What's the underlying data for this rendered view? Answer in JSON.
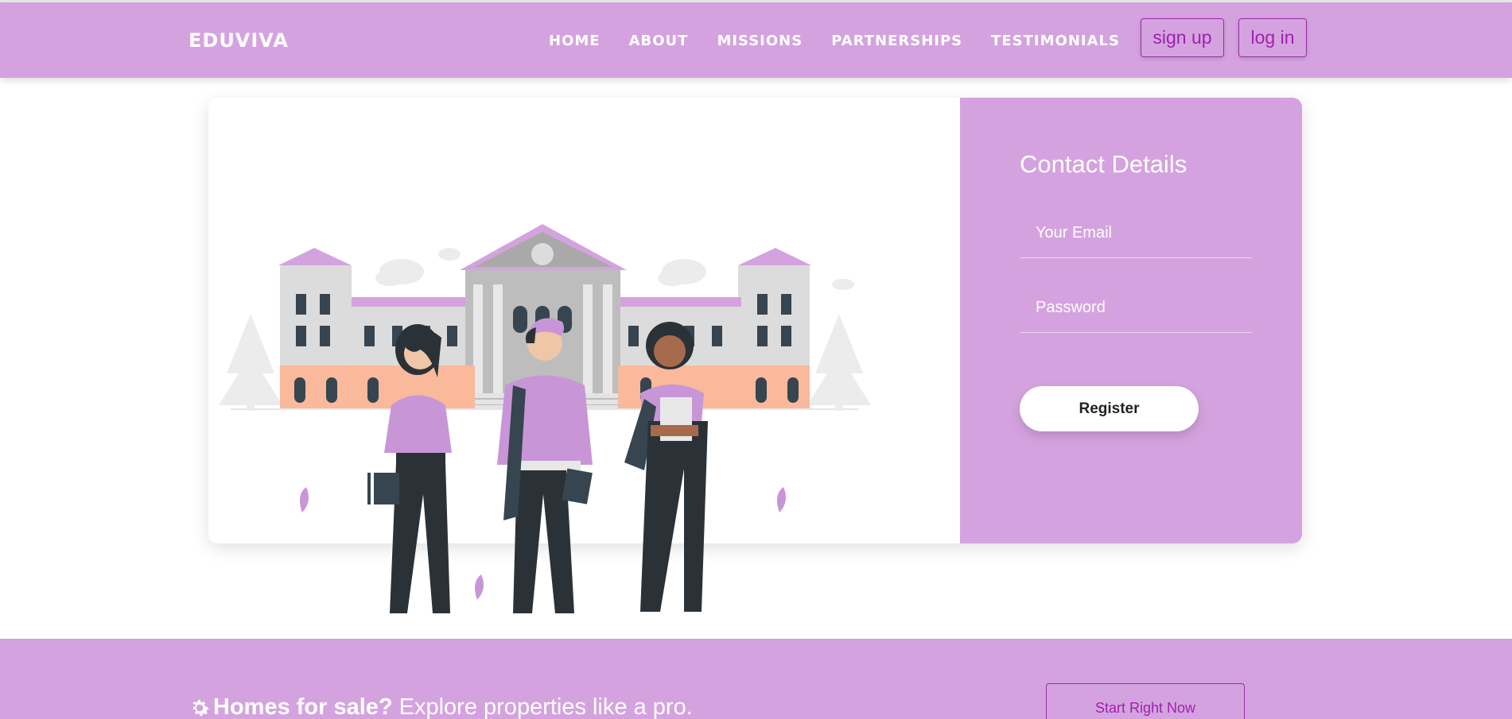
{
  "brand": "EDUVIVA",
  "nav": {
    "links": [
      "HOME",
      "ABOUT",
      "MISSIONS",
      "PARTNERSHIPS",
      "TESTIMONIALS"
    ],
    "signup": "sign up",
    "login": "log in"
  },
  "contact": {
    "title": "Contact Details",
    "email_placeholder": "Your Email",
    "password_placeholder": "Password",
    "register": "Register"
  },
  "footer": {
    "headline_bold": "Homes for sale?",
    "headline_rest": "Explore properties like a pro.",
    "cta": "Start Right Now",
    "icon": "gear-icon"
  },
  "colors": {
    "accent": "#d4a3df",
    "button_border": "#9b2ba8",
    "button_text": "#a020b0"
  }
}
